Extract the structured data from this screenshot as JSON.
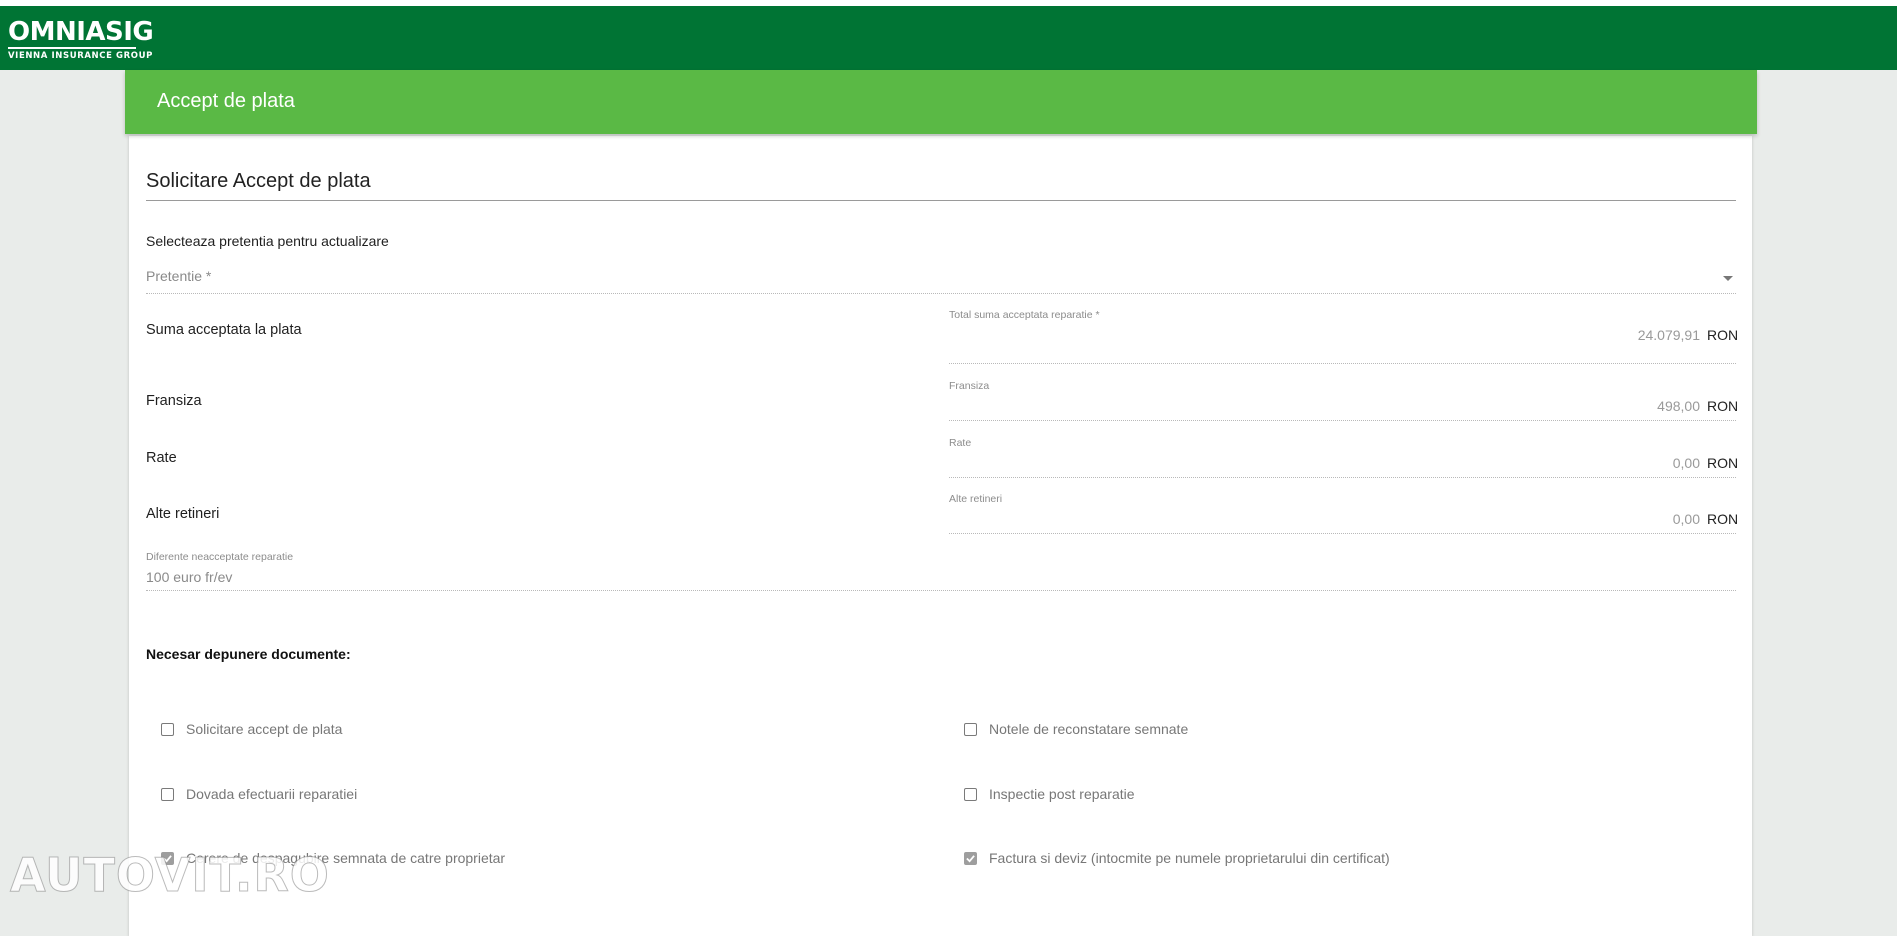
{
  "brand": {
    "name": "OMNIASIG",
    "tagline": "VIENNA INSURANCE GROUP"
  },
  "card": {
    "header_title": "Accept de plata",
    "section_title": "Solicitare Accept de plata"
  },
  "claim_select": {
    "label": "Selecteaza pretentia pentru actualizare",
    "placeholder": "Pretentie *"
  },
  "rows": [
    {
      "label": "Suma acceptata la plata",
      "field_label": "Total suma acceptata reparatie *",
      "value": "24.079,91",
      "unit": "RON"
    },
    {
      "label": "Fransiza",
      "field_label": "Fransiza",
      "value": "498,00",
      "unit": "RON"
    },
    {
      "label": "Rate",
      "field_label": "Rate",
      "value": "0,00",
      "unit": "RON"
    },
    {
      "label": "Alte retineri",
      "field_label": "Alte retineri",
      "value": "0,00",
      "unit": "RON"
    }
  ],
  "differences": {
    "label": "Diferente neacceptate reparatie",
    "value": "100 euro fr/ev"
  },
  "documents": {
    "heading": "Necesar depunere documente:",
    "items": [
      {
        "label": "Solicitare accept de plata",
        "checked": false
      },
      {
        "label": "Notele de reconstatare semnate",
        "checked": false
      },
      {
        "label": "Dovada efectuarii reparatiei",
        "checked": false
      },
      {
        "label": "Inspectie post reparatie",
        "checked": false
      },
      {
        "label": "Cerere de despagubire semnata de catre proprietar",
        "checked": true
      },
      {
        "label": "Factura si deviz (intocmite pe numele proprietarului din certificat)",
        "checked": true
      }
    ]
  },
  "watermark": "AUTOVIT.RO",
  "colors": {
    "topbar": "#007434",
    "card_header": "#5ab945",
    "background": "#e9ecea"
  }
}
